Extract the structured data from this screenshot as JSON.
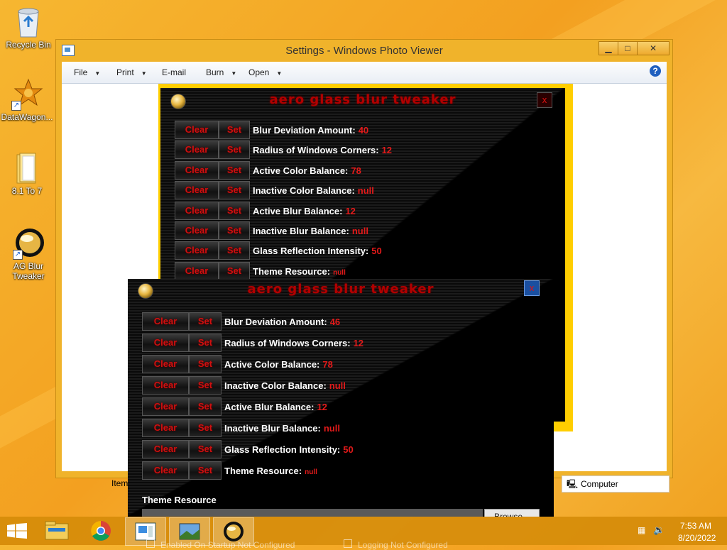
{
  "desktop": {
    "icons": [
      {
        "label": "Recycle Bin",
        "icon": "recycle-bin-icon"
      },
      {
        "label": "DataWagon...",
        "icon": "datawagon-icon"
      },
      {
        "label": "8.1 To 7",
        "icon": "folder-icon"
      },
      {
        "label": "AG Blur\nTweaker",
        "icon": "ag-blur-tweaker-icon"
      }
    ]
  },
  "photo_viewer": {
    "title": "Settings - Windows Photo Viewer",
    "menu": [
      "File",
      "Print",
      "E-mail",
      "Burn",
      "Open"
    ],
    "status_left": "Item",
    "status_right": "Computer"
  },
  "tweaker_back": {
    "title": "aero glass blur tweaker",
    "close": "x",
    "rows": [
      {
        "clear": "Clear",
        "set": "Set",
        "label": "Blur Deviation Amount:",
        "value": "40"
      },
      {
        "clear": "Clear",
        "set": "Set",
        "label": "Radius of Windows Corners:",
        "value": "12"
      },
      {
        "clear": "Clear",
        "set": "Set",
        "label": "Active Color Balance:",
        "value": "78"
      },
      {
        "clear": "Clear",
        "set": "Set",
        "label": "Inactive Color Balance:",
        "value": "null"
      },
      {
        "clear": "Clear",
        "set": "Set",
        "label": "Active Blur Balance:",
        "value": "12"
      },
      {
        "clear": "Clear",
        "set": "Set",
        "label": "Inactive Blur Balance:",
        "value": "null"
      },
      {
        "clear": "Clear",
        "set": "Set",
        "label": "Glass Reflection Intensity:",
        "value": "50"
      },
      {
        "clear": "Clear",
        "set": "Set",
        "label": "Theme Resource:",
        "value": "null"
      }
    ]
  },
  "tweaker_front": {
    "title": "aero glass blur tweaker",
    "close": "x",
    "rows": [
      {
        "clear": "Clear",
        "set": "Set",
        "label": "Blur Deviation Amount:",
        "value": "46"
      },
      {
        "clear": "Clear",
        "set": "Set",
        "label": "Radius of Windows Corners:",
        "value": "12"
      },
      {
        "clear": "Clear",
        "set": "Set",
        "label": "Active Color Balance:",
        "value": "78"
      },
      {
        "clear": "Clear",
        "set": "Set",
        "label": "Inactive Color Balance:",
        "value": "null"
      },
      {
        "clear": "Clear",
        "set": "Set",
        "label": "Active Blur Balance:",
        "value": "12"
      },
      {
        "clear": "Clear",
        "set": "Set",
        "label": "Inactive Blur Balance:",
        "value": "null"
      },
      {
        "clear": "Clear",
        "set": "Set",
        "label": "Glass Reflection Intensity:",
        "value": "50"
      },
      {
        "clear": "Clear",
        "set": "Set",
        "label": "Theme Resource:",
        "value": "null"
      }
    ],
    "theme_resource_heading": "Theme Resource",
    "browse": "Browse...",
    "bottom_options": [
      "Enabled On Startup Not Configured",
      "Logging Not Configured"
    ]
  },
  "taskbar": {
    "time": "7:53 AM",
    "date": "8/20/2022",
    "buttons": [
      "file-explorer-icon",
      "chrome-icon",
      "windows-photo-viewer-icon",
      "photos-icon",
      "ag-blur-tweaker-icon"
    ]
  },
  "colors": {
    "accent_red": "#e31a1a",
    "desktop": "#f3a020",
    "taskbar": "#d68c0a"
  }
}
